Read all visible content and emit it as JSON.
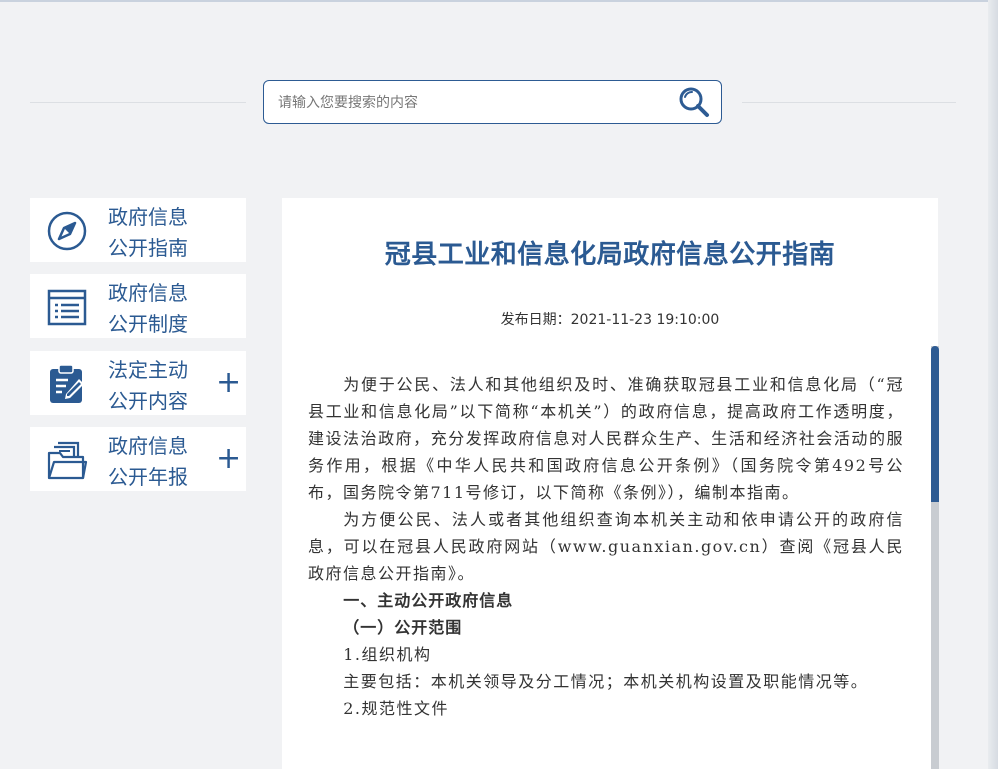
{
  "search": {
    "placeholder": "请输入您要搜索的内容"
  },
  "sidebar": {
    "items": [
      {
        "line1": "政府信息",
        "line2": "公开指南",
        "icon": "compass-icon",
        "expandable": false
      },
      {
        "line1": "政府信息",
        "line2": "公开制度",
        "icon": "document-list-icon",
        "expandable": false
      },
      {
        "line1": "法定主动",
        "line2": "公开内容",
        "icon": "clipboard-edit-icon",
        "expandable": true,
        "expand_symbol": "+"
      },
      {
        "line1": "政府信息",
        "line2": "公开年报",
        "icon": "folder-icon",
        "expandable": true,
        "expand_symbol": "+"
      }
    ]
  },
  "article": {
    "title": "冠县工业和信息化局政府信息公开指南",
    "date": "发布日期：2021-11-23 19:10:00",
    "paragraphs": [
      "为便于公民、法人和其他组织及时、准确获取冠县工业和信息化局（“冠县工业和信息化局”以下简称“本机关”）的政府信息，提高政府工作透明度，建设法治政府，充分发挥政府信息对人民群众生产、生活和经济社会活动的服务作用，根据《中华人民共和国政府信息公开条例》（国务院令第492号公布，国务院令第711号修订，以下简称《条例》），编制本指南。",
      "为方便公民、法人或者其他组织查询本机关主动和依申请公开的政府信息，可以在冠县人民政府网站（www.guanxian.gov.cn）查阅《冠县人民政府信息公开指南》。"
    ],
    "heading1": "一、主动公开政府信息",
    "heading2": "（一）公开范围",
    "item1": "1.组织机构",
    "item1_text": "主要包括：本机关领导及分工情况；本机关机构设置及职能情况等。",
    "item2": "2.规范性文件"
  },
  "colors": {
    "accent": "#2b5a92",
    "background": "#f1f2f4",
    "panel": "#ffffff"
  }
}
